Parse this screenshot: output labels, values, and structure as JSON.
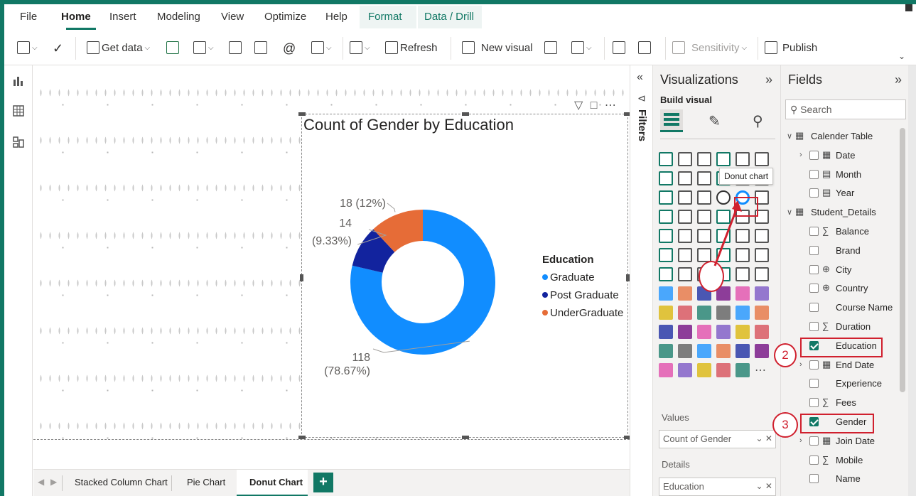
{
  "menu": {
    "file": "File",
    "home": "Home",
    "insert": "Insert",
    "modeling": "Modeling",
    "view": "View",
    "optimize": "Optimize",
    "help": "Help",
    "format": "Format",
    "data_drill": "Data / Drill"
  },
  "ribbon": {
    "get_data": "Get data",
    "refresh": "Refresh",
    "new_visual": "New visual",
    "sensitivity": "Sensitivity",
    "publish": "Publish"
  },
  "visual": {
    "title": "Count of Gender by Education",
    "legend_title": "Education"
  },
  "chart_data": {
    "type": "pie",
    "subtype": "donut",
    "title": "Count of Gender by Education",
    "legend_title": "Education",
    "legend_position": "right",
    "categories": [
      "Graduate",
      "Post Graduate",
      "UnderGraduate"
    ],
    "values": [
      118,
      14,
      18
    ],
    "data_labels": [
      "118 (78.67%)",
      "14 (9.33%)",
      "18 (12%)"
    ],
    "label_lines": [
      [
        "118",
        "(78.67%)"
      ],
      [
        "14",
        "(9.33%)"
      ],
      [
        "18 (12%)"
      ]
    ],
    "colors": [
      "#118dff",
      "#12239e",
      "#e66c37"
    ]
  },
  "filters": {
    "label": "Filters"
  },
  "visualizations": {
    "title": "Visualizations",
    "build_visual": "Build visual",
    "tooltip": "Donut chart",
    "values_label": "Values",
    "values_well": "Count of Gender",
    "details_label": "Details",
    "details_well": "Education"
  },
  "fields": {
    "title": "Fields",
    "search_placeholder": "Search",
    "items": [
      {
        "name": "Calender Table",
        "kind": "table"
      },
      {
        "name": "Date",
        "kind": "date"
      },
      {
        "name": "Month",
        "kind": "calc"
      },
      {
        "name": "Year",
        "kind": "calc"
      },
      {
        "name": "Student_Details",
        "kind": "table"
      },
      {
        "name": "Balance",
        "kind": "sum"
      },
      {
        "name": "Brand",
        "kind": "text"
      },
      {
        "name": "City",
        "kind": "geo"
      },
      {
        "name": "Country",
        "kind": "geo"
      },
      {
        "name": "Course Name",
        "kind": "text"
      },
      {
        "name": "Duration",
        "kind": "sum"
      },
      {
        "name": "Education",
        "kind": "text",
        "checked": true
      },
      {
        "name": "End Date",
        "kind": "date"
      },
      {
        "name": "Experience",
        "kind": "text"
      },
      {
        "name": "Fees",
        "kind": "sum"
      },
      {
        "name": "Gender",
        "kind": "text",
        "checked": true
      },
      {
        "name": "Join Date",
        "kind": "date"
      },
      {
        "name": "Mobile",
        "kind": "sum"
      },
      {
        "name": "Name",
        "kind": "text"
      }
    ]
  },
  "annotations": {
    "step2": "2",
    "step3": "3"
  },
  "pages": {
    "tab1": "Stacked Column Chart",
    "tab2": "Pie Chart",
    "tab3": "Donut Chart",
    "add": "+"
  }
}
